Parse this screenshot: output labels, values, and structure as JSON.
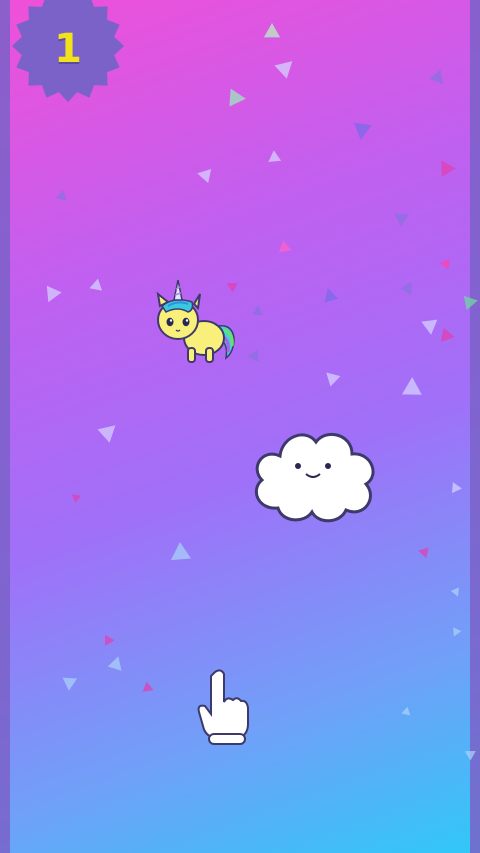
{
  "game": {
    "score": "1",
    "colors": {
      "background_top": "#f050d8",
      "background_bottom": "#30c8f8",
      "score_badge": "#7a62c8",
      "score_text": "#f2e21c",
      "side_bars": "#7a62c8"
    },
    "player": {
      "icon": "unicorn-icon"
    },
    "obstacle": {
      "icon": "cloud-icon"
    },
    "hint": {
      "icon": "tap-hand-icon"
    }
  }
}
